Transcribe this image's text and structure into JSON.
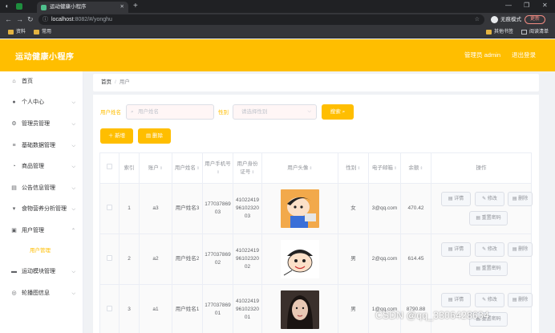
{
  "browser": {
    "tab_title": "运动健康小程序",
    "address_host": "localhost",
    "address_path": ":8082/#/yonghu",
    "incognito_label": "无痕模式",
    "update_label": "更新",
    "bookmarks": [
      "资料",
      "常用"
    ],
    "bookmarks_right": [
      "其他书签",
      "阅读清单"
    ]
  },
  "header": {
    "app_title": "运动健康小程序",
    "admin_label": "管理员 admin",
    "logout_label": "退出登录"
  },
  "sidebar": {
    "items": [
      {
        "label": "首页",
        "icon": "home-icon"
      },
      {
        "label": "个人中心",
        "icon": "user-icon"
      },
      {
        "label": "管理员管理",
        "icon": "gear-icon"
      },
      {
        "label": "基础数据管理",
        "icon": "list-icon"
      },
      {
        "label": "商品管理",
        "icon": "goods-icon"
      },
      {
        "label": "公告信息管理",
        "icon": "notice-icon"
      },
      {
        "label": "食物营养分析管理",
        "icon": "food-icon"
      },
      {
        "label": "用户管理",
        "icon": "users-icon"
      },
      {
        "label": "运动模块管理",
        "icon": "sport-icon"
      },
      {
        "label": "轮播图信息",
        "icon": "carousel-icon"
      }
    ],
    "submenu_active": "用户管理"
  },
  "breadcrumb": {
    "home": "首页",
    "separator": "/",
    "current": "用户"
  },
  "filters": {
    "name_label": "用户姓名",
    "name_placeholder": "用户姓名",
    "gender_label": "性别",
    "gender_placeholder": "请选择性别",
    "search_button": "搜索"
  },
  "actions": {
    "add": "新增",
    "delete": "删除"
  },
  "table": {
    "headers": {
      "index": "索引",
      "account": "账户",
      "name": "用户姓名",
      "phone": "用户手机号",
      "idcard": "用户身份证号",
      "avatar": "用户头像",
      "gender": "性别",
      "email": "电子邮箱",
      "balance": "余额",
      "ops": "操作"
    },
    "rows": [
      {
        "index": "1",
        "account": "a3",
        "name": "用户姓名3",
        "phone": "17703786903",
        "idcard": "410224199610232003",
        "gender": "女",
        "email": "3@qq.com",
        "balance": "470.42"
      },
      {
        "index": "2",
        "account": "a2",
        "name": "用户姓名2",
        "phone": "17703786902",
        "idcard": "410224199610232002",
        "gender": "男",
        "email": "2@qq.com",
        "balance": "614.45"
      },
      {
        "index": "3",
        "account": "a1",
        "name": "用户姓名1",
        "phone": "17703786901",
        "idcard": "410224199610232001",
        "gender": "男",
        "email": "1@qq.com",
        "balance": "8790.88"
      }
    ],
    "op_labels": {
      "detail": "详情",
      "edit": "修改",
      "delete": "删除",
      "reset": "重置密码"
    }
  },
  "watermark": "CSDN @qq_3306428634",
  "colors": {
    "brand": "#ffbe00",
    "sidebar_bg": "#ffffff",
    "page_bg": "#f0f2f5"
  }
}
